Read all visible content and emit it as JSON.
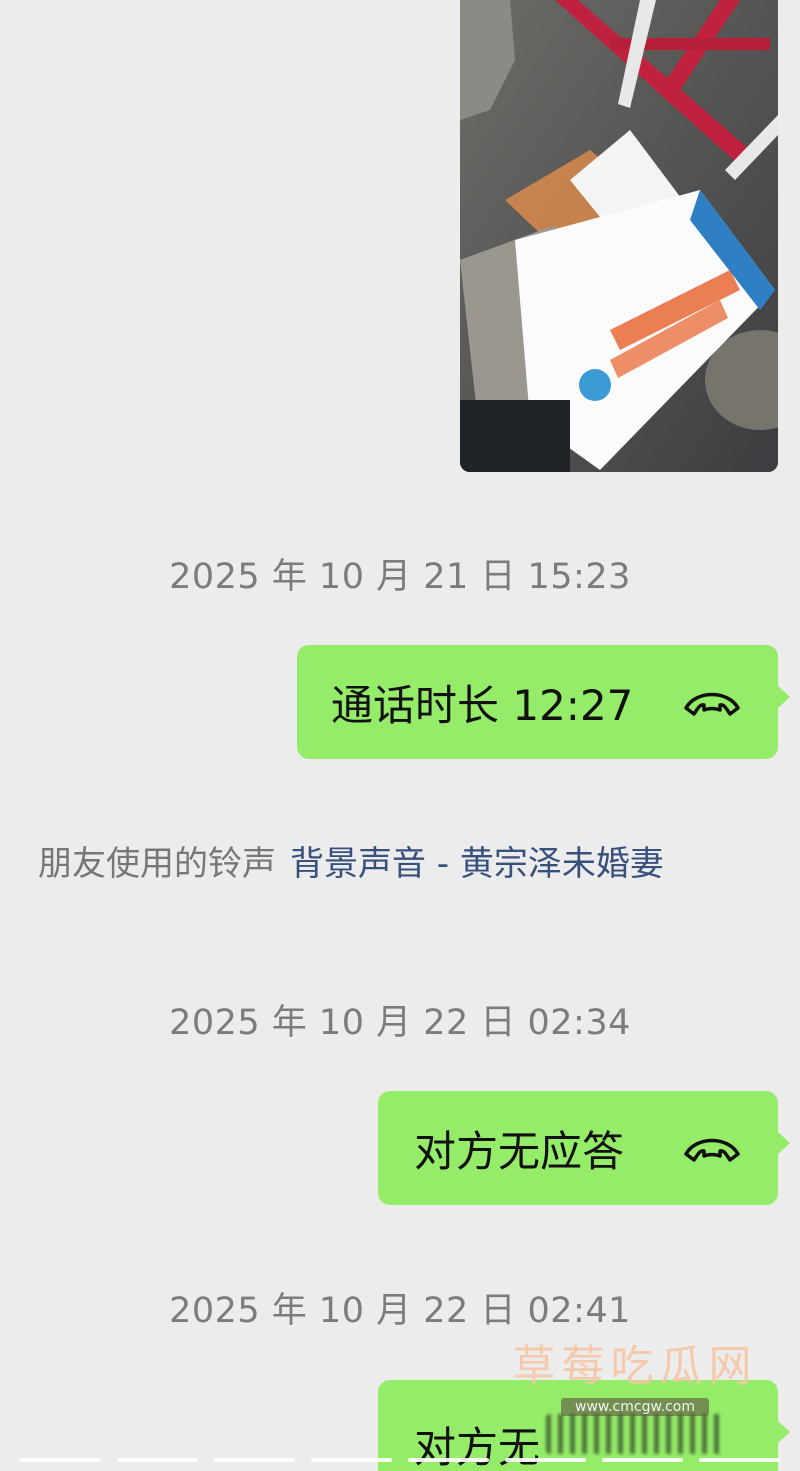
{
  "chat": {
    "image_message": {
      "alt_icon": "photo-of-medicine-box-icon"
    },
    "timestamps": [
      "2025 年 10 月 21 日 15:23",
      "2025 年 10 月 22 日 02:34",
      "2025 年 10 月 22 日 02:41"
    ],
    "messages": [
      {
        "text": "通话时长 12:27",
        "icon": "phone-hangup-icon"
      },
      {
        "text": "对方无应答",
        "icon": "phone-hangup-icon"
      },
      {
        "text": "对方无",
        "icon": ""
      }
    ],
    "ringtone": {
      "label": "朋友使用的铃声",
      "link": "背景声音 - 黄宗泽未婚妻"
    }
  },
  "watermark": {
    "title": "草莓吃瓜网",
    "url": "www.cmcgw.com"
  },
  "colors": {
    "background": "#ececec",
    "bubble_green": "#95ec69",
    "timestamp_gray": "#7c7c7c",
    "link_blue": "#38517c"
  }
}
